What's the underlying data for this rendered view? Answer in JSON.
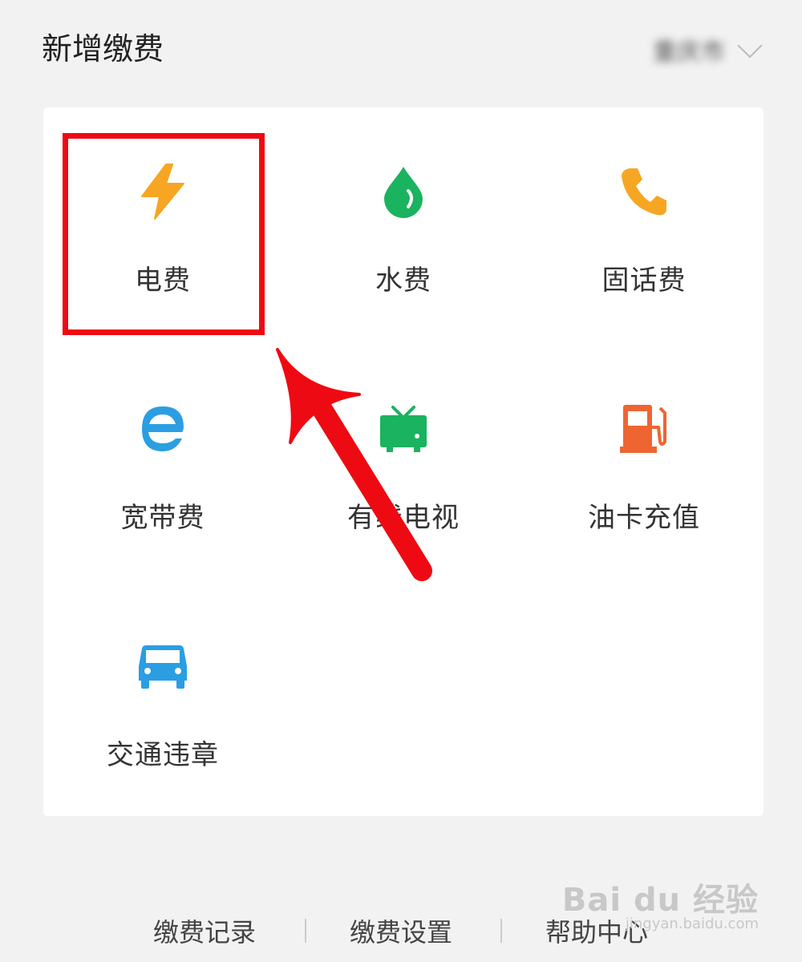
{
  "header": {
    "title": "新增缴费",
    "city": "重庆市"
  },
  "services": [
    {
      "label": "电费",
      "icon": "lightning-icon",
      "color": "#f6a623"
    },
    {
      "label": "水费",
      "icon": "water-drop-icon",
      "color": "#1ab35f"
    },
    {
      "label": "固话费",
      "icon": "phone-icon",
      "color": "#f6a623"
    },
    {
      "label": "宽带费",
      "icon": "ie-e-icon",
      "color": "#2b9ee3"
    },
    {
      "label": "有线电视",
      "icon": "tv-icon",
      "color": "#1ab35f"
    },
    {
      "label": "油卡充值",
      "icon": "fuel-pump-icon",
      "color": "#ef6532"
    },
    {
      "label": "交通违章",
      "icon": "car-icon",
      "color": "#2b9ee3"
    }
  ],
  "annotation": {
    "highlight_color": "#ee0a12"
  },
  "footer": {
    "records": "缴费记录",
    "settings": "缴费设置",
    "help": "帮助中心"
  },
  "watermark": {
    "brand": "Bai du 经验",
    "url": "jingyan.baidu.com"
  }
}
